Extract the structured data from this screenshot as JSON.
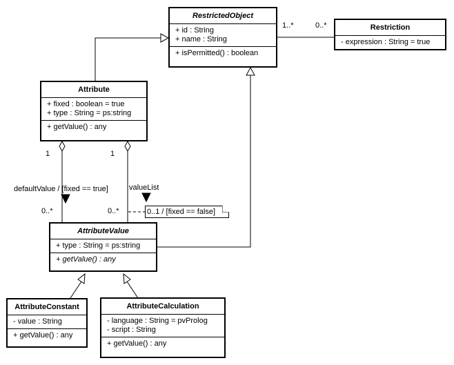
{
  "diagram": {
    "type": "UML class diagram",
    "classes": {
      "restricted_object": {
        "name": "RestrictedObject",
        "abstract": true,
        "attributes": [
          "+ id : String",
          "+ name : String"
        ],
        "operations": [
          "+ isPermitted() : boolean"
        ]
      },
      "restriction": {
        "name": "Restriction",
        "abstract": false,
        "attributes": [
          "- expression : String = true"
        ],
        "operations": []
      },
      "attribute": {
        "name": "Attribute",
        "abstract": false,
        "attributes": [
          "+ fixed : boolean = true",
          "+ type : String = ps:string"
        ],
        "operations": [
          "+ getValue() : any"
        ]
      },
      "attribute_value": {
        "name": "AttributeValue",
        "abstract": true,
        "attributes": [
          "+ type : String = ps:string"
        ],
        "operations": [
          "+ getValue() : any"
        ]
      },
      "attribute_constant": {
        "name": "AttributeConstant",
        "abstract": false,
        "attributes": [
          "- value : String"
        ],
        "operations": [
          "+ getValue() : any"
        ]
      },
      "attribute_calculation": {
        "name": "AttributeCalculation",
        "abstract": false,
        "attributes": [
          "- language : String = pvProlog",
          "- script : String"
        ],
        "operations": [
          "+ getValue() : any"
        ]
      }
    },
    "relationships": {
      "restricted_restriction": {
        "kind": "association",
        "source_multiplicity": "1..*",
        "target_multiplicity": "0..*"
      },
      "default_value": {
        "kind": "aggregation",
        "source_multiplicity": "1",
        "target_multiplicity": "0..*",
        "label": "defaultValue / [fixed == true]"
      },
      "value_list": {
        "kind": "aggregation",
        "source_multiplicity": "1",
        "target_multiplicity": "0..*",
        "label": "valueList",
        "note": "0..1 / [fixed == false]"
      },
      "generalizations": [
        "Attribute -> RestrictedObject",
        "AttributeValue -> RestrictedObject",
        "AttributeConstant -> AttributeValue",
        "AttributeCalculation -> AttributeValue"
      ]
    }
  }
}
